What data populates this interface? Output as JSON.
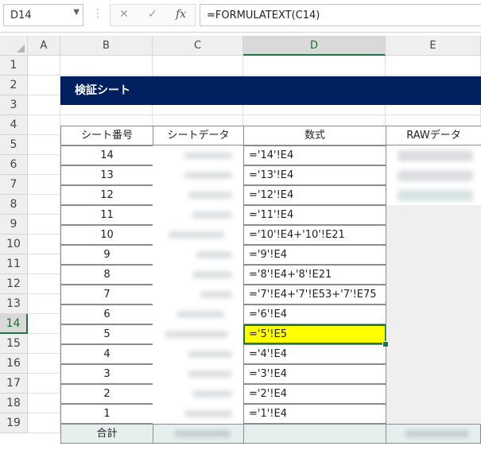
{
  "formula_bar": {
    "name_box": "D14",
    "formula": "=FORMULATEXT(C14)",
    "cancel_glyph": "✕",
    "enter_glyph": "✓",
    "fx_glyph": "fx"
  },
  "columns": [
    "A",
    "B",
    "C",
    "D",
    "E"
  ],
  "rows": [
    "1",
    "2",
    "3",
    "4",
    "5",
    "6",
    "7",
    "8",
    "9",
    "10",
    "11",
    "12",
    "13",
    "14",
    "15",
    "16",
    "17",
    "18",
    "19"
  ],
  "selected_cell": {
    "column": "D",
    "row": "14"
  },
  "title": "検証シート",
  "table": {
    "headers": {
      "sheet_no": "シート番号",
      "sheet_data": "シートデータ",
      "formula": "数式",
      "raw": "RAWデータ"
    },
    "sheet_numbers": [
      "14",
      "13",
      "12",
      "11",
      "10",
      "9",
      "8",
      "7",
      "6",
      "5",
      "4",
      "3",
      "2",
      "1"
    ],
    "formulas": [
      "='14'!E4",
      "='13'!E4",
      "='12'!E4",
      "='11'!E4",
      "='10'!E4+'10'!E21",
      "='9'!E4",
      "='8'!E4+'8'!E21",
      "='7'!E4+'7'!E53+'7'!E75",
      "='6'!E4",
      "='5'!E5",
      "='4'!E4",
      "='3'!E4",
      "='2'!E4",
      "='1'!E4"
    ],
    "total_label": "合計"
  },
  "colors": {
    "title_bg": "#002060",
    "selected_fill": "#ffff00",
    "accent": "#217346"
  }
}
